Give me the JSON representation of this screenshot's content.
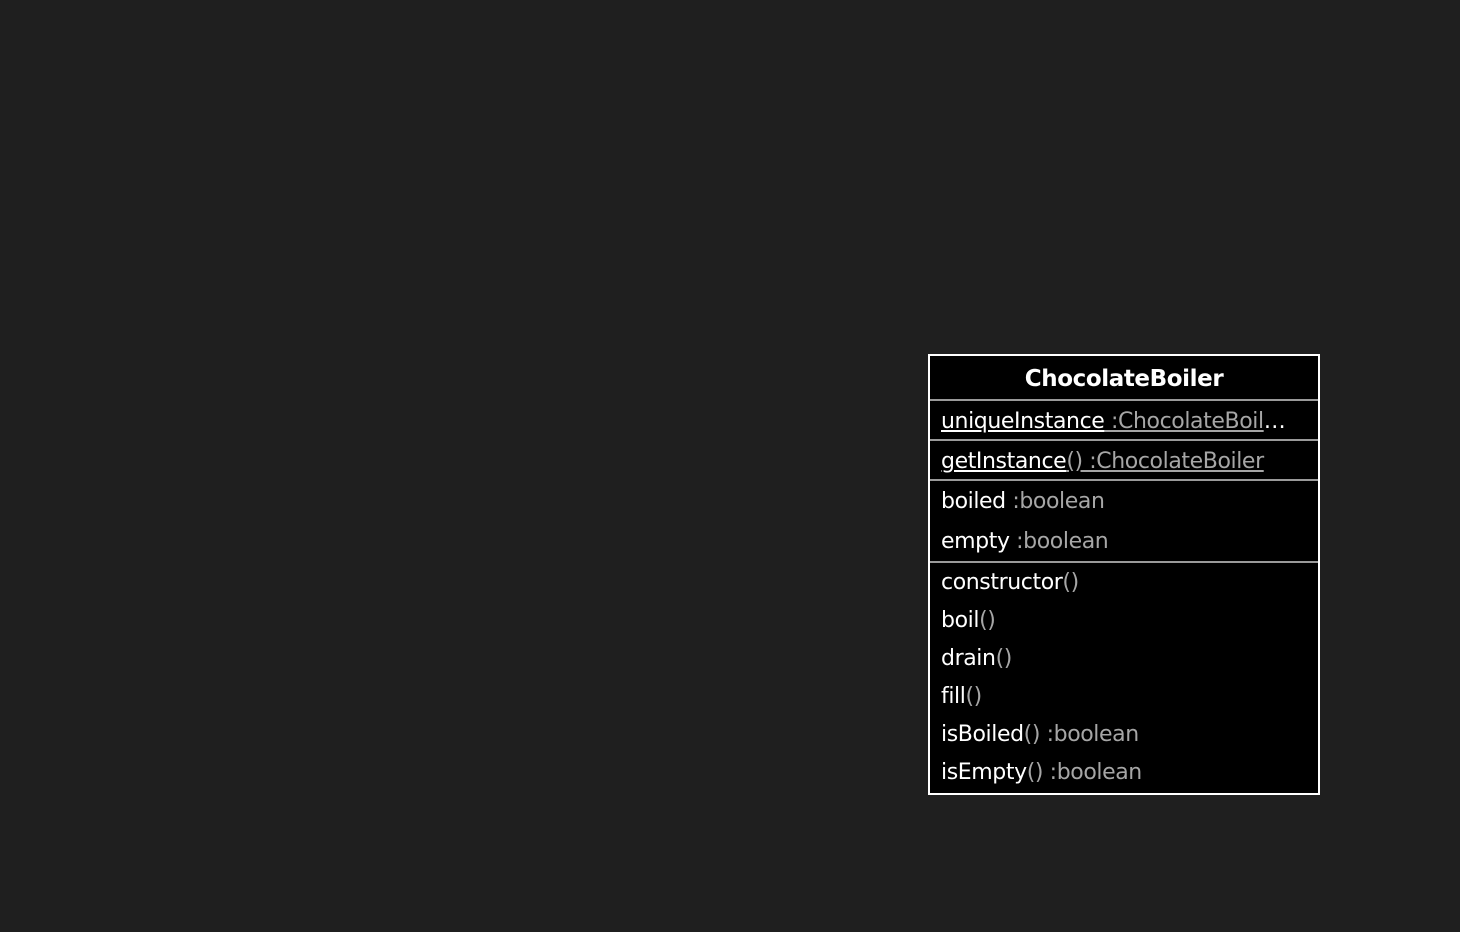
{
  "class": {
    "name": "ChocolateBoiler",
    "static_attributes": [
      {
        "name": "uniqueInstance",
        "type": " :ChocolateBoil",
        "truncated": "…"
      }
    ],
    "static_methods": [
      {
        "name": "getInstance",
        "signature": "() :ChocolateBoiler"
      }
    ],
    "attributes": [
      {
        "name": "boiled",
        "type": " :boolean"
      },
      {
        "name": "empty",
        "type": " :boolean"
      }
    ],
    "methods": [
      {
        "name": "constructor",
        "signature": "()"
      },
      {
        "name": "boil",
        "signature": "()"
      },
      {
        "name": "drain",
        "signature": "()"
      },
      {
        "name": "fill",
        "signature": "()"
      },
      {
        "name": "isBoiled",
        "signature": "() :boolean"
      },
      {
        "name": "isEmpty",
        "signature": "() :boolean"
      }
    ]
  }
}
